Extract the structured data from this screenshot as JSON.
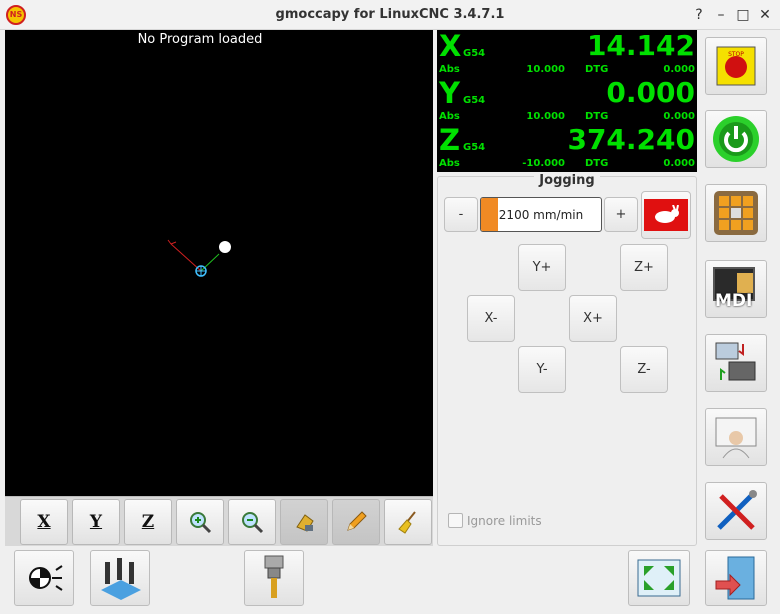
{
  "window": {
    "title": "gmoccapy for LinuxCNC  3.4.7.1",
    "app_icon_text": "NS"
  },
  "preview": {
    "message": "No Program loaded"
  },
  "preview_tools": [
    "view-x-button",
    "view-y-button",
    "view-z-button",
    "zoom-in-button",
    "zoom-out-button",
    "delete-view-button",
    "edit-button",
    "clear-plot-button"
  ],
  "view_labels": {
    "x": "X",
    "y": "Y",
    "z": "Z"
  },
  "dro": {
    "rows": [
      {
        "axis": "X",
        "coord": "G54",
        "value": "14.142",
        "abs_label": "Abs",
        "abs": "10.000",
        "dtg_label": "DTG",
        "dtg": "0.000"
      },
      {
        "axis": "Y",
        "coord": "G54",
        "value": "0.000",
        "abs_label": "Abs",
        "abs": "10.000",
        "dtg_label": "DTG",
        "dtg": "0.000"
      },
      {
        "axis": "Z",
        "coord": "G54",
        "value": "374.240",
        "abs_label": "Abs",
        "abs": "-10.000",
        "dtg_label": "DTG",
        "dtg": "0.000"
      }
    ],
    "color": "#00e000"
  },
  "jogging": {
    "title": "Jogging",
    "minus_label": "-",
    "plus_label": "+",
    "speed_text": "2100 mm/min",
    "speed_fraction": 0.14,
    "buttons": {
      "y_plus": "Y+",
      "z_plus": "Z+",
      "x_minus": "X-",
      "x_plus": "X+",
      "y_minus": "Y-",
      "z_minus": "Z-"
    },
    "ignore_limits": "Ignore limits"
  },
  "right_buttons": [
    "emergency-stop-button",
    "machine-power-button",
    "manual-mode-button",
    "mdi-button",
    "auto-mode-button",
    "settings-page-button",
    "setup-tools-button"
  ],
  "mdi_label": "MDI",
  "bottom_buttons": [
    "touch-off-button",
    "tool-measure-button",
    "tool-button",
    "fullscreen-toggle-button",
    "exit-button"
  ]
}
